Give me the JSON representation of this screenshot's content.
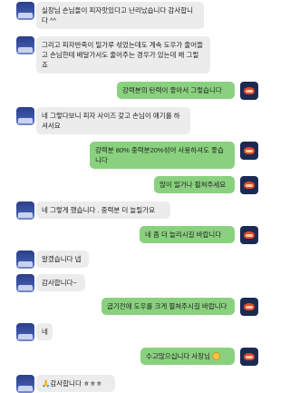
{
  "messages": [
    {
      "side": "left",
      "text": "실장님 손님들이 피자맛있다고 난리났습니다 감사합니다 ^^"
    },
    {
      "side": "left",
      "text": "그리고 피자반죽이 밀가루 섞었는데도 계속 도우가 줄어들고 손님한테 배달가서도 줄어주는 경우가 있는데 왜 그럴죠"
    },
    {
      "side": "right",
      "text": "강력분의 탄력이 좋아서 그렇습니다"
    },
    {
      "side": "left",
      "text": "네 그렇다보니 피자 사이즈 갖고 손님이 얘기를 하셔서요"
    },
    {
      "side": "right",
      "text": "강력분 80% 중력분20%섞어 사용하셔도 좋습니다"
    },
    {
      "side": "right",
      "text": "많이 밀거나 펼쳐주세요"
    },
    {
      "side": "left",
      "text": "네 그렇게 했습니다 . 중력분 더 늘릴가요"
    },
    {
      "side": "right",
      "text": "네 좀 더 늘리시길 바랍니다"
    },
    {
      "side": "left",
      "text": "알겠습니다 넵"
    },
    {
      "side": "left",
      "text": "감사합니다~"
    },
    {
      "side": "right",
      "text": "굽기전에 도우를 크게 펼쳐주시길 바랍니다"
    },
    {
      "side": "left",
      "text": "네"
    },
    {
      "side": "right",
      "text": "수고많으십니다 사장님",
      "emoji": "smiling-face-emoji"
    },
    {
      "side": "left",
      "text": "🙏감사합니다 ㅎㅎㅎ"
    }
  ],
  "colors": {
    "outgoing": "#8ad17f",
    "incoming": "#ececec",
    "background": "#ffffff"
  }
}
